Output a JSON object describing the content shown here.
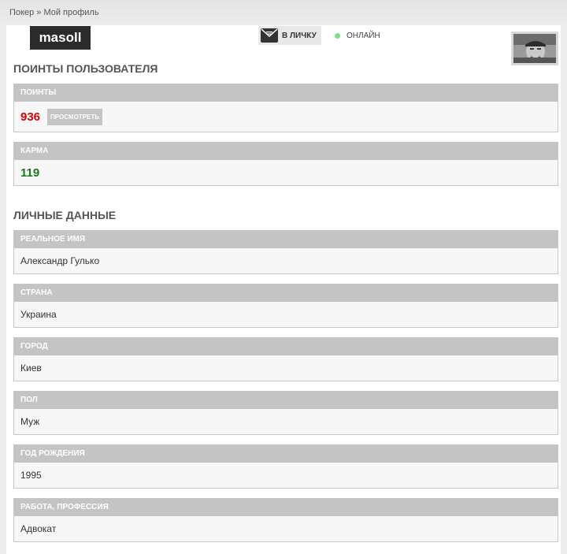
{
  "breadcrumb": {
    "home": "Покер",
    "sep": " » ",
    "current": "Мой профиль"
  },
  "header": {
    "username": "masoll",
    "pm_label": "В ЛИЧКУ",
    "online_label": "ОНЛАЙН"
  },
  "sections": {
    "points_title": "ПОИНТЫ ПОЛЬЗОВАТЕЛЯ",
    "personal_title": "ЛИЧНЫЕ ДАННЫЕ"
  },
  "points": {
    "label": "ПОИНТЫ",
    "value": "936",
    "view_button": "ПРОСМОТРЕТЬ"
  },
  "karma": {
    "label": "КАРМА",
    "value": "119"
  },
  "fields": [
    {
      "label": "РЕАЛЬНОЕ ИМЯ",
      "value": "Александр Гулько"
    },
    {
      "label": "СТРАНА",
      "value": "Украина"
    },
    {
      "label": "ГОРОД",
      "value": "Киев"
    },
    {
      "label": "ПОЛ",
      "value": "Муж"
    },
    {
      "label": "ГОД РОЖДЕНИЯ",
      "value": "1995"
    },
    {
      "label": "РАБОТА, ПРОФЕССИЯ",
      "value": "Адвокат"
    }
  ],
  "colors": {
    "points": "#dd0000",
    "karma": "#1a7a1a",
    "online": "#7ee07e",
    "field_header": "#c4c4c4"
  }
}
